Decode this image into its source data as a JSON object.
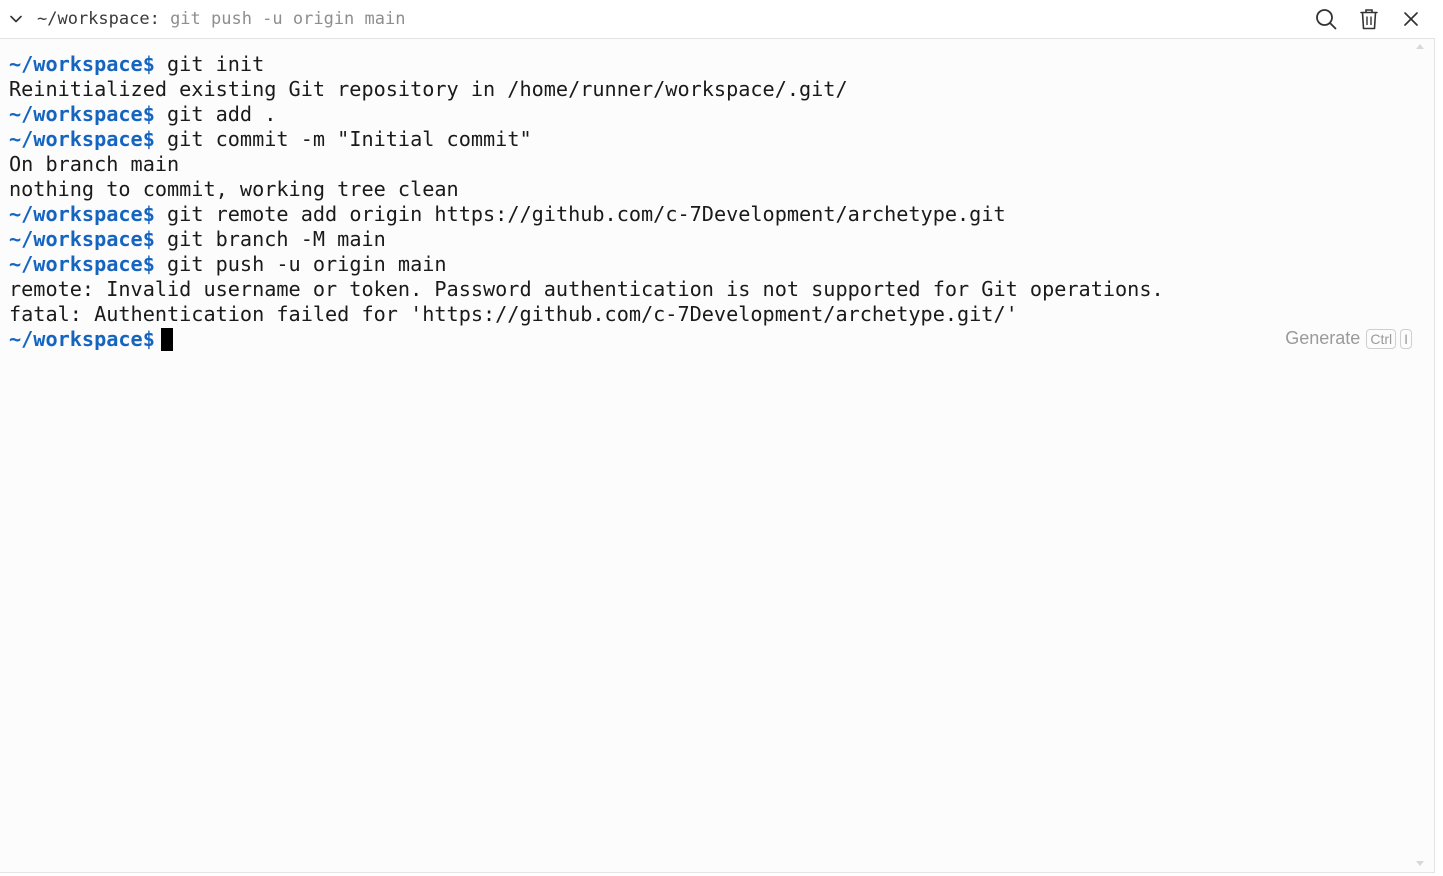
{
  "header": {
    "path": "~/workspace:",
    "command": " git push -u origin main",
    "icons": [
      "chevron-down-icon",
      "search-icon",
      "trash-icon",
      "close-icon"
    ]
  },
  "terminal": {
    "prompt": "~/workspace$",
    "lines": [
      {
        "type": "cmd",
        "text": " git init"
      },
      {
        "type": "out",
        "text": "Reinitialized existing Git repository in /home/runner/workspace/.git/"
      },
      {
        "type": "cmd",
        "text": " git add ."
      },
      {
        "type": "cmd",
        "text": " git commit -m \"Initial commit\""
      },
      {
        "type": "out",
        "text": "On branch main"
      },
      {
        "type": "out",
        "text": "nothing to commit, working tree clean"
      },
      {
        "type": "cmd",
        "text": " git remote add origin https://github.com/c-7Development/archetype.git"
      },
      {
        "type": "cmd",
        "text": " git branch -M main"
      },
      {
        "type": "cmd",
        "text": " git push -u origin main"
      },
      {
        "type": "out",
        "text": "remote: Invalid username or token. Password authentication is not supported for Git operations."
      },
      {
        "type": "out",
        "text": "fatal: Authentication failed for 'https://github.com/c-7Development/archetype.git/'"
      }
    ]
  },
  "generate": {
    "label": "Generate",
    "keys": [
      "Ctrl",
      "I"
    ]
  },
  "colors": {
    "prompt": "#1565c0",
    "text": "#1a1a1a",
    "hint": "#9a9a9a"
  }
}
